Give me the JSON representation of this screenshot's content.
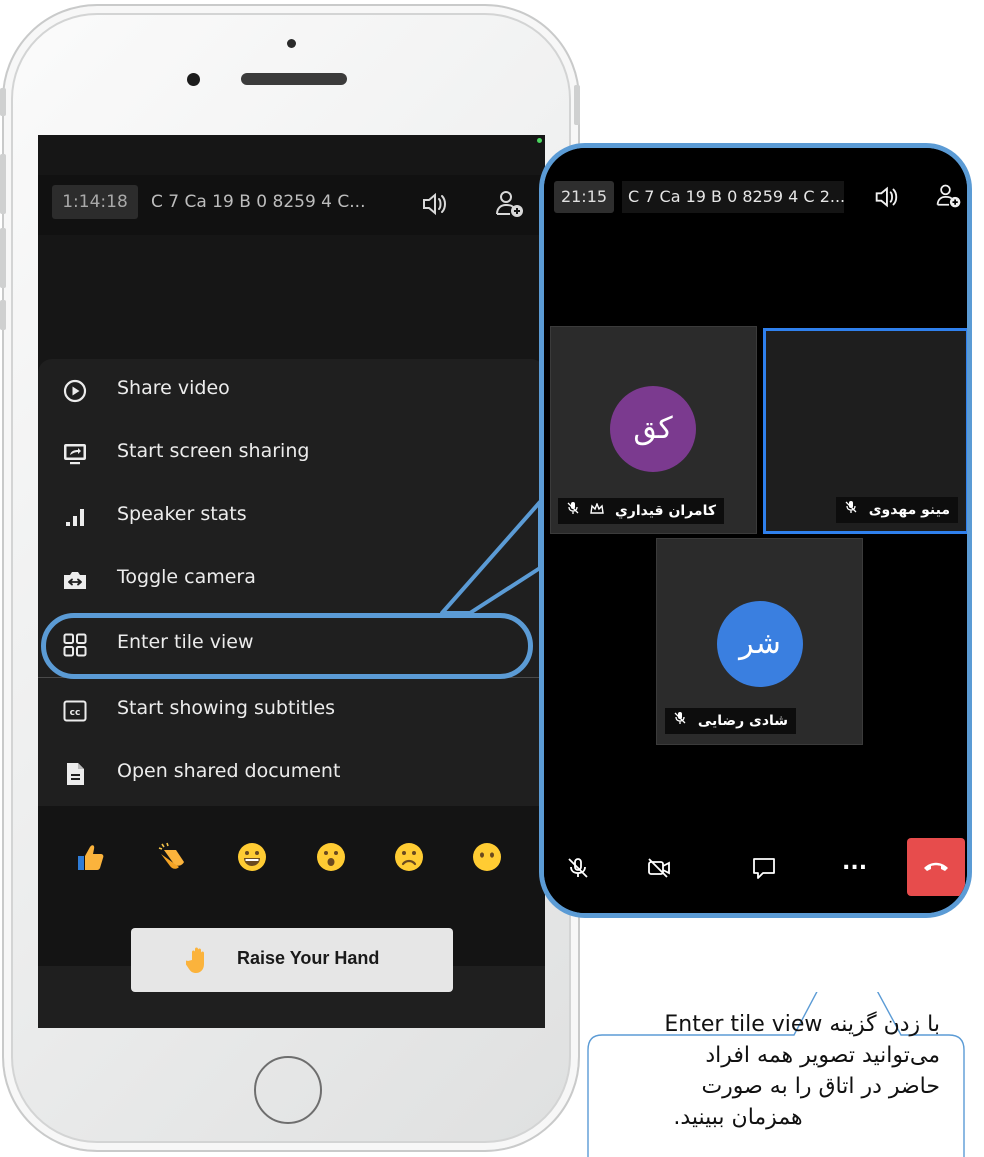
{
  "phone": {
    "timer": "1:14:18",
    "room_name": "C 7 Ca 19 B 0 8259 4 C...",
    "menu": [
      {
        "label": "Share video",
        "icon": "play-circle-icon"
      },
      {
        "label": "Start screen sharing",
        "icon": "screen-share-icon"
      },
      {
        "label": "Speaker stats",
        "icon": "bar-chart-icon"
      },
      {
        "label": "Toggle camera",
        "icon": "camera-switch-icon"
      },
      {
        "label": "Enter tile view",
        "icon": "tile-grid-icon"
      },
      {
        "label": "Start showing subtitles",
        "icon": "closed-captions-icon"
      },
      {
        "label": "Open shared document",
        "icon": "document-icon"
      }
    ],
    "reactions": [
      "👍",
      "👏",
      "😀",
      "😮",
      "🙁",
      "😶"
    ],
    "raise_hand_label": "Raise Your Hand",
    "raise_hand_emoji": "✋"
  },
  "inset": {
    "timer": "21:15",
    "room_name": "C 7 Ca 19 B 0 8259 4 C 2...",
    "participants": [
      {
        "name": "كامران قيداري",
        "initials": "کق",
        "avatar_color": "#7b3a8f",
        "moderator": true,
        "muted": true
      },
      {
        "name": "مینو مهدوی",
        "initials": "",
        "avatar_color": "",
        "moderator": false,
        "muted": true,
        "active": true
      },
      {
        "name": "شادی رضایی",
        "initials": "شر",
        "avatar_color": "#3a7fe0",
        "moderator": false,
        "muted": true
      }
    ],
    "more_label": "..."
  },
  "callout": {
    "lines": [
      "با زدن گزینه Enter tile view",
      "می‌توانید تصویر همه افراد",
      "حاضر در اتاق را به صورت",
      "همزمان ببینید."
    ]
  },
  "colors": {
    "highlight": "#5b9bd5",
    "active_tile": "#2f80ed",
    "hangup": "#e74c4c"
  }
}
